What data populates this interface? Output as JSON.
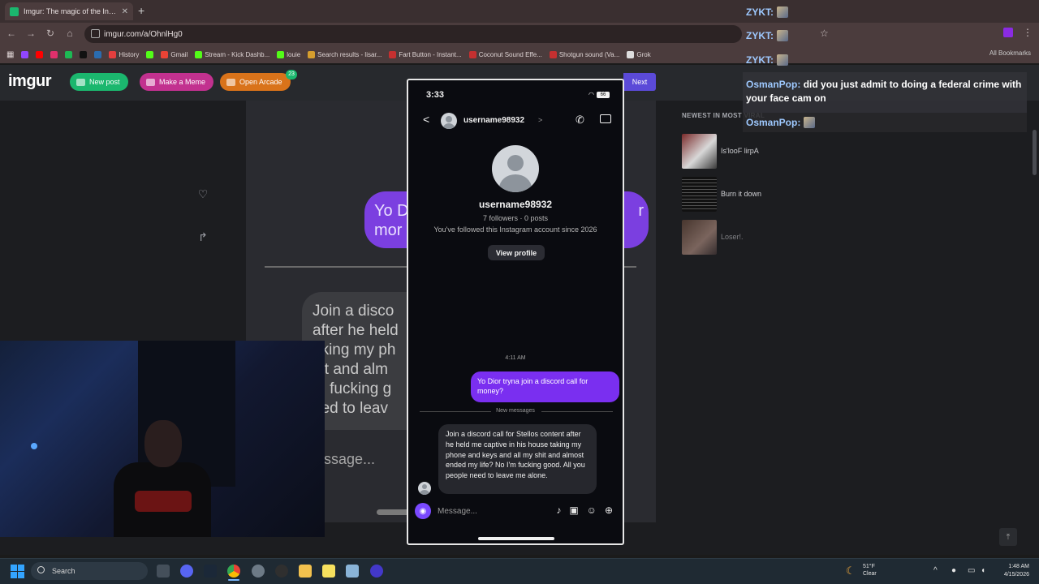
{
  "browser": {
    "tab_title": "Imgur: The magic of the Internet",
    "url": "imgur.com/a/OhnlHg0",
    "bookmarks": [
      {
        "label": "",
        "color": "#9146ff"
      },
      {
        "label": "",
        "color": "#ff0000"
      },
      {
        "label": "",
        "color": "#e1306c"
      },
      {
        "label": "",
        "color": "#1db954"
      },
      {
        "label": "",
        "color": "#111111"
      },
      {
        "label": "",
        "color": "#2b6cb0"
      },
      {
        "label": "History",
        "color": "#e53e3e"
      },
      {
        "label": "",
        "color": "#53fc18"
      },
      {
        "label": "Gmail",
        "color": "#ea4335"
      },
      {
        "label": "Stream - Kick Dashb...",
        "color": "#53fc18"
      },
      {
        "label": "louie",
        "color": "#53fc18"
      },
      {
        "label": "Search results - lisar...",
        "color": "#d69e2e"
      },
      {
        "label": "Fart Button - Instant...",
        "color": "#c53030"
      },
      {
        "label": "Coconut Sound Effe...",
        "color": "#c53030"
      },
      {
        "label": "Shotgun sound (Va...",
        "color": "#c53030"
      },
      {
        "label": "Grok",
        "color": "#dddddd"
      }
    ],
    "all_bookmarks": "All Bookmarks"
  },
  "imgur": {
    "logo": "imgur",
    "new_post": "New post",
    "make_meme": "Make a Meme",
    "open_arcade": "Open Arcade",
    "arcade_badge": "23",
    "next": "Next",
    "newest_header": "NEWEST IN MOST VIRAL",
    "newest": [
      {
        "title": "Is'looF lirpA"
      },
      {
        "title": "Burn it down"
      },
      {
        "title": "Loser!."
      }
    ],
    "bg_bubble_left": "Yo D mor",
    "bg_bubble_right": "r",
    "bg_grey_lines": [
      "Join a disco",
      "after he held",
      "aking my ph",
      "hit and alm",
      "m fucking g",
      "eed to leav"
    ],
    "bg_message": "ssage..."
  },
  "phone": {
    "time": "3:33",
    "battery": "66",
    "username": "username98932",
    "followers": "7 followers · 0 posts",
    "since": "You've followed this Instagram account since 2026",
    "view_profile": "View profile",
    "timestamp": "4:11 AM",
    "sent_message": "Yo Dior tryna join a discord call for money?",
    "new_messages": "New messages",
    "received_message": "Join a discord call for Stellos content after he held me captive in his house taking my phone and keys and all my shit and almost ended my life? No I'm fucking good. All you people need to leave me alone.",
    "composer_placeholder": "Message..."
  },
  "chat": {
    "rows": [
      {
        "name": "ZYKT:"
      },
      {
        "name": "ZYKT:"
      },
      {
        "name": "ZYKT:"
      }
    ],
    "message_name": "OsmanPop:",
    "message_text": "did you just admit to doing a federal crime with your face cam on",
    "last_name": "OsmanPop:"
  },
  "taskbar": {
    "search": "Search",
    "temp": "51°F",
    "condition": "Clear",
    "time": "1:48 AM",
    "date": "4/15/2026"
  }
}
